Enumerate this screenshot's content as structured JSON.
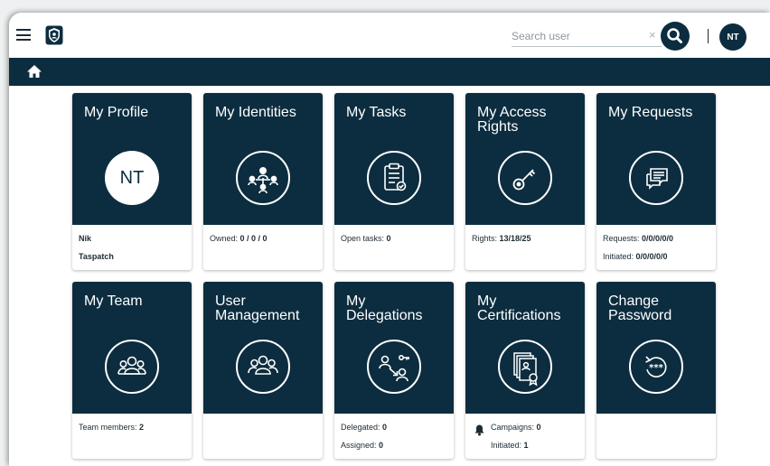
{
  "header": {
    "search_placeholder": "Search user",
    "user_initials": "NT",
    "clear_glyph": "×",
    "accent_color": "#0c2d3f"
  },
  "tiles": {
    "profile": {
      "title": "My Profile",
      "initials": "NT",
      "line1": "Nik",
      "line2": "Taspatch",
      "icon": "avatar-initials"
    },
    "identities": {
      "title": "My Identities",
      "owned_label": "Owned: ",
      "owned_value": "0 / 0 / 0",
      "icon": "identities-network-icon"
    },
    "tasks": {
      "title": "My Tasks",
      "open_label": "Open tasks: ",
      "open_value": "0",
      "icon": "clipboard-check-icon"
    },
    "access_rights": {
      "title": "My Access\nRights",
      "rights_label": "Rights: ",
      "rights_value": "13/18/25",
      "icon": "key-icon"
    },
    "requests": {
      "title": "My Requests",
      "requests_label": "Requests: ",
      "requests_value": "0/0/0/0/0",
      "initiated_label": "Initiated: ",
      "initiated_value": "0/0/0/0/0",
      "icon": "chat-bubbles-icon"
    },
    "team": {
      "title": "My Team",
      "members_label": "Team members: ",
      "members_value": "2",
      "icon": "team-icon"
    },
    "user_management": {
      "title": "User\nManagement",
      "icon": "user-group-icon"
    },
    "delegations": {
      "title": "My\nDelegations",
      "delegated_label": "Delegated: ",
      "delegated_value": "0",
      "assigned_label": "Assigned: ",
      "assigned_value": "0",
      "icon": "delegation-icon"
    },
    "certifications": {
      "title": "My\nCertifications",
      "campaigns_label": "Campaigns: ",
      "campaigns_value": "0",
      "initiated_label": "Initiated: ",
      "initiated_value": "1",
      "icon": "certificate-icon"
    },
    "change_password": {
      "title": "Change\nPassword",
      "icon": "password-reset-icon"
    }
  }
}
